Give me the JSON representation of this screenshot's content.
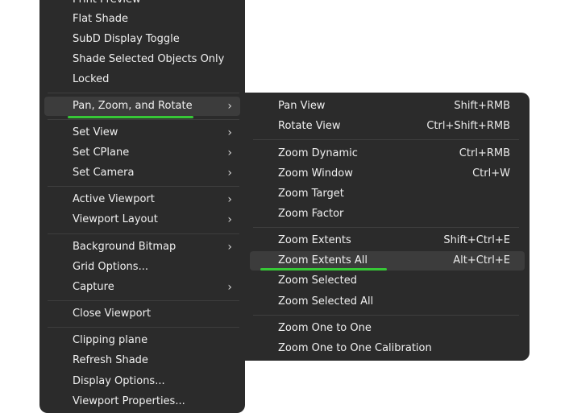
{
  "main_menu": {
    "items": [
      {
        "label": "Print Preview"
      },
      {
        "label": "Flat Shade"
      },
      {
        "label": "SubD Display Toggle"
      },
      {
        "label": "Shade Selected Objects Only"
      },
      {
        "label": "Locked"
      },
      {
        "label": "Pan, Zoom, and Rotate",
        "submenu": true,
        "chevron": "›"
      },
      {
        "label": "Set View",
        "submenu": true,
        "chevron": "›"
      },
      {
        "label": "Set CPlane",
        "submenu": true,
        "chevron": "›"
      },
      {
        "label": "Set Camera",
        "submenu": true,
        "chevron": "›"
      },
      {
        "label": "Active Viewport",
        "submenu": true,
        "chevron": "›"
      },
      {
        "label": "Viewport Layout",
        "submenu": true,
        "chevron": "›"
      },
      {
        "label": "Background Bitmap",
        "submenu": true,
        "chevron": "›"
      },
      {
        "label": "Grid Options..."
      },
      {
        "label": "Capture",
        "submenu": true,
        "chevron": "›"
      },
      {
        "label": "Close Viewport"
      },
      {
        "label": "Clipping plane"
      },
      {
        "label": "Refresh Shade"
      },
      {
        "label": "Display Options..."
      },
      {
        "label": "Viewport Properties..."
      }
    ]
  },
  "sub_menu": {
    "items": [
      {
        "label": "Pan View",
        "shortcut": "Shift+RMB"
      },
      {
        "label": "Rotate View",
        "shortcut": "Ctrl+Shift+RMB"
      },
      {
        "label": "Zoom Dynamic",
        "shortcut": "Ctrl+RMB"
      },
      {
        "label": "Zoom Window",
        "shortcut": "Ctrl+W"
      },
      {
        "label": "Zoom Target",
        "shortcut": ""
      },
      {
        "label": "Zoom Factor",
        "shortcut": ""
      },
      {
        "label": "Zoom Extents",
        "shortcut": "Shift+Ctrl+E"
      },
      {
        "label": "Zoom Extents All",
        "shortcut": "Alt+Ctrl+E"
      },
      {
        "label": "Zoom Selected",
        "shortcut": ""
      },
      {
        "label": "Zoom Selected All",
        "shortcut": ""
      },
      {
        "label": "Zoom One to One",
        "shortcut": ""
      },
      {
        "label": "Zoom One to One Calibration",
        "shortcut": ""
      }
    ]
  },
  "colors": {
    "menu_bg": "#2b2b2b",
    "hover_bg": "#3c3c3c",
    "separator": "#3e3e3e",
    "highlight_underline": "#37c837",
    "text": "#f0f0f0"
  }
}
